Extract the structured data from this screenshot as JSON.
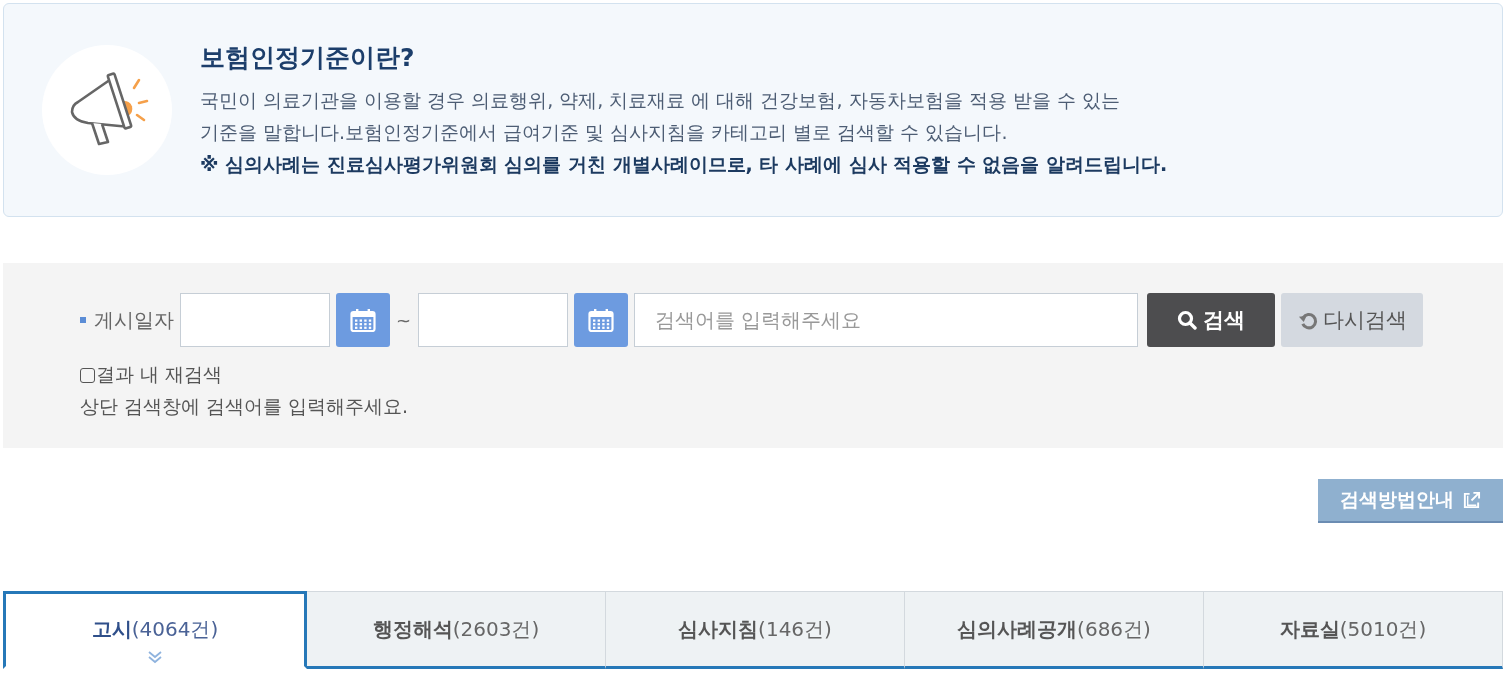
{
  "notice": {
    "title": "보험인정기준이란?",
    "description": [
      "국민이 의료기관을 이용할 경우 의료행위, 약제, 치료재료 에 대해 건강보험, 자동차보험을 적용 받을 수 있는",
      "기준을 말합니다.보험인정기준에서 급여기준 및 심사지침을 카테고리 별로 검색할 수 있습니다."
    ],
    "note": "※ 심의사례는 진료심사평가위원회 심의를 거친 개별사례이므로, 타 사례에 심사 적용할 수 없음을 알려드립니다."
  },
  "search": {
    "date_label": "게시일자",
    "separator": "~",
    "placeholder": "검색어를 입력해주세요",
    "buttons": [
      {
        "kind": "search",
        "label": "검색"
      },
      {
        "kind": "reset",
        "label": "다시검색"
      }
    ],
    "refine": {
      "label": "결과 내 재검색",
      "checked": false
    },
    "hint": "상단 검색창에 검색어를 입력해주세요."
  },
  "guide_button": {
    "label": "검색방법안내"
  },
  "tabs": [
    {
      "label": "고시",
      "count": "(4064건)",
      "selected": true
    },
    {
      "label": "행정해석",
      "count": "(2603건)",
      "selected": false
    },
    {
      "label": "심사지침",
      "count": "(146건)",
      "selected": false
    },
    {
      "label": "심의사례공개",
      "count": "(686건)",
      "selected": false
    },
    {
      "label": "자료실",
      "count": "(5010건)",
      "selected": false
    }
  ]
}
